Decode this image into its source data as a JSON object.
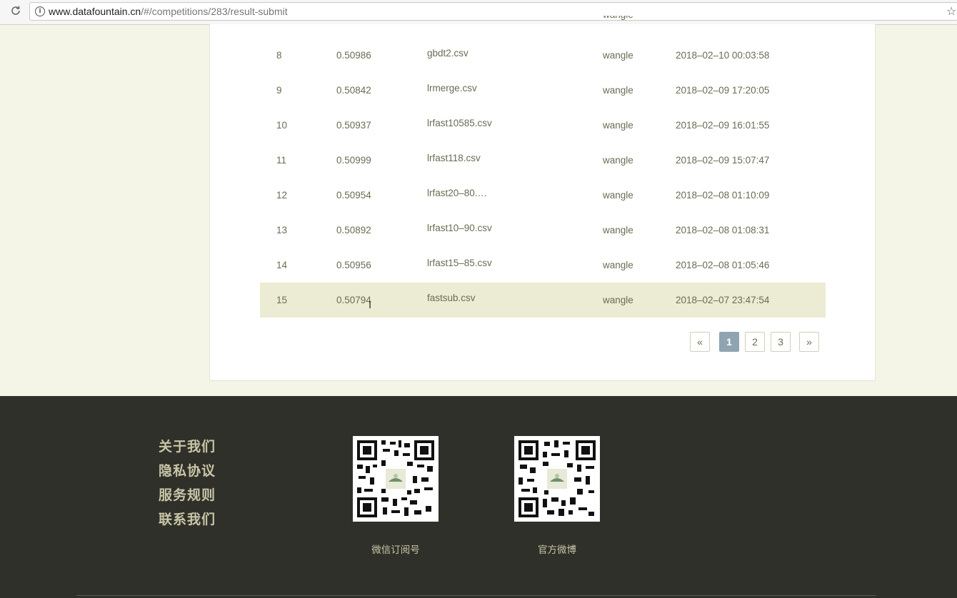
{
  "browser": {
    "url_domain": "www.datafountain.cn",
    "url_path": "/#/competitions/283/result-submit"
  },
  "partial_row": {
    "user": "wangle"
  },
  "rows": [
    {
      "rank": "8",
      "score": "0.50986",
      "file": "gbdt2.csv",
      "user": "wangle",
      "time": "2018–02–10 00:03:58"
    },
    {
      "rank": "9",
      "score": "0.50842",
      "file": "lrmerge.csv",
      "user": "wangle",
      "time": "2018–02–09 17:20:05"
    },
    {
      "rank": "10",
      "score": "0.50937",
      "file": "lrfast10585.csv",
      "user": "wangle",
      "time": "2018–02–09 16:01:55"
    },
    {
      "rank": "11",
      "score": "0.50999",
      "file": "lrfast118.csv",
      "user": "wangle",
      "time": "2018–02–09 15:07:47"
    },
    {
      "rank": "12",
      "score": "0.50954",
      "file": "lrfast20–80.…",
      "user": "wangle",
      "time": "2018–02–08 01:10:09"
    },
    {
      "rank": "13",
      "score": "0.50892",
      "file": "lrfast10–90.csv",
      "user": "wangle",
      "time": "2018–02–08 01:08:31"
    },
    {
      "rank": "14",
      "score": "0.50956",
      "file": "lrfast15–85.csv",
      "user": "wangle",
      "time": "2018–02–08 01:05:46"
    },
    {
      "rank": "15",
      "score": "0.50794",
      "file": "fastsub.csv",
      "user": "wangle",
      "time": "2018–02–07 23:47:54"
    }
  ],
  "pagination": {
    "prev": "«",
    "pages": [
      "1",
      "2",
      "3"
    ],
    "next": "»",
    "current": "1"
  },
  "footer": {
    "links": [
      "关于我们",
      "隐私协议",
      "服务规则",
      "联系我们"
    ],
    "qr_labels": [
      "微信订阅号",
      "官方微博"
    ]
  },
  "colors": {
    "accent": "#8fa3b0",
    "highlight_row": "#ecebd3",
    "footer_bg": "#30302a",
    "page_bg": "#f4f5e6"
  }
}
